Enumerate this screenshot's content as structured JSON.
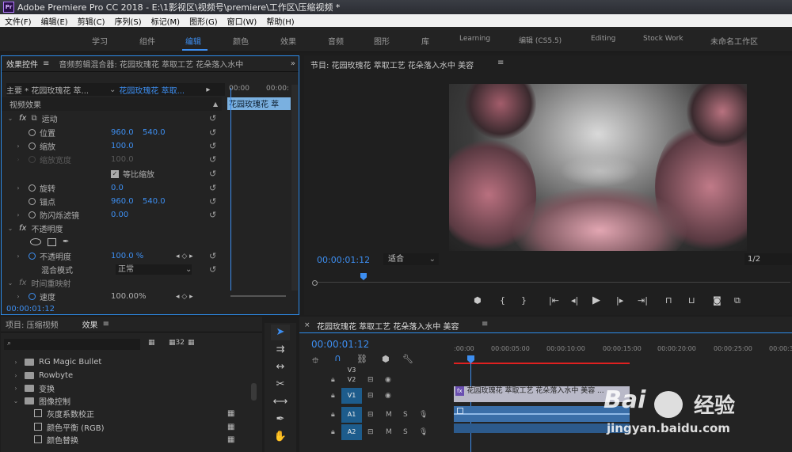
{
  "window": {
    "title": "Adobe Premiere Pro CC 2018 - E:\\1影视区\\视频号\\premiere\\工作区\\压缩视频 *",
    "logo": "Pr"
  },
  "menu": [
    "文件(F)",
    "编辑(E)",
    "剪辑(C)",
    "序列(S)",
    "标记(M)",
    "图形(G)",
    "窗口(W)",
    "帮助(H)"
  ],
  "workspaces": [
    "学习",
    "组件",
    "编辑",
    "颜色",
    "效果",
    "音频",
    "图形",
    "库",
    "Learning",
    "编辑 (CS5.5)",
    "Editing",
    "Stock Work",
    "未命名工作区"
  ],
  "active_workspace": "编辑",
  "effect_controls": {
    "tab1": "效果控件",
    "tab2": "音频剪辑混合器: 花园玫瑰花 萃取工艺 花朵落入水中",
    "master": "主要 * 花园玫瑰花 萃...",
    "clip": "花园玫瑰花 萃取...",
    "time_start": "00:00",
    "time_end": "00:00:",
    "clip_bar": "花园玫瑰花 萃",
    "section_video": "视频效果",
    "motion": "运动",
    "position": {
      "label": "位置",
      "x": "960.0",
      "y": "540.0"
    },
    "scale": {
      "label": "缩放",
      "value": "100.0"
    },
    "scale_width": {
      "label": "缩放宽度",
      "value": "100.0"
    },
    "uniform": "等比缩放",
    "rotation": {
      "label": "旋转",
      "value": "0.0"
    },
    "anchor": {
      "label": "锚点",
      "x": "960.0",
      "y": "540.0"
    },
    "flicker": {
      "label": "防闪烁滤镜",
      "value": "0.00"
    },
    "opacity_section": "不透明度",
    "opacity": {
      "label": "不透明度",
      "value": "100.0 %"
    },
    "blend": {
      "label": "混合模式",
      "value": "正常"
    },
    "time_remap": "时间重映射",
    "speed": {
      "label": "速度",
      "value": "100.00%"
    },
    "timecode": "00:00:01:12"
  },
  "monitor": {
    "title": "节目: 花园玫瑰花 萃取工艺 花朵落入水中 美容",
    "timecode": "00:00:01:12",
    "fit": "适合",
    "quality": "1/2"
  },
  "project": {
    "tab1": "项目: 压缩视频",
    "tab2": "效果",
    "items": [
      {
        "name": "RG Magic Bullet",
        "level": 1
      },
      {
        "name": "Rowbyte",
        "level": 1
      },
      {
        "name": "变换",
        "level": 1
      },
      {
        "name": "图像控制",
        "level": 1,
        "open": true
      },
      {
        "name": "灰度系数校正",
        "level": 2
      },
      {
        "name": "颜色平衡 (RGB)",
        "level": 2
      },
      {
        "name": "颜色替换",
        "level": 2
      }
    ]
  },
  "timeline": {
    "title": "花园玫瑰花 萃取工艺 花朵落入水中 美容",
    "timecode": "00:00:01:12",
    "ruler": [
      ":00:00",
      "00:00:05:00",
      "00:00:10:00",
      "00:00:15:00",
      "00:00:20:00",
      "00:00:25:00",
      "00:00:3"
    ],
    "tracks": [
      {
        "name": "V3"
      },
      {
        "name": "V2"
      },
      {
        "name": "V1"
      },
      {
        "name": "A1"
      },
      {
        "name": "A2"
      }
    ],
    "video_clip": "花园玫瑰花 萃取工艺 花朵落入水中 美容 ...",
    "m_label": "M",
    "s_label": "S"
  },
  "watermark": {
    "brand": "Bai",
    "brand2": "经验",
    "url": "jingyan.baidu.com"
  },
  "colors": {
    "accent": "#3d8ef0",
    "red": "#e02020"
  }
}
